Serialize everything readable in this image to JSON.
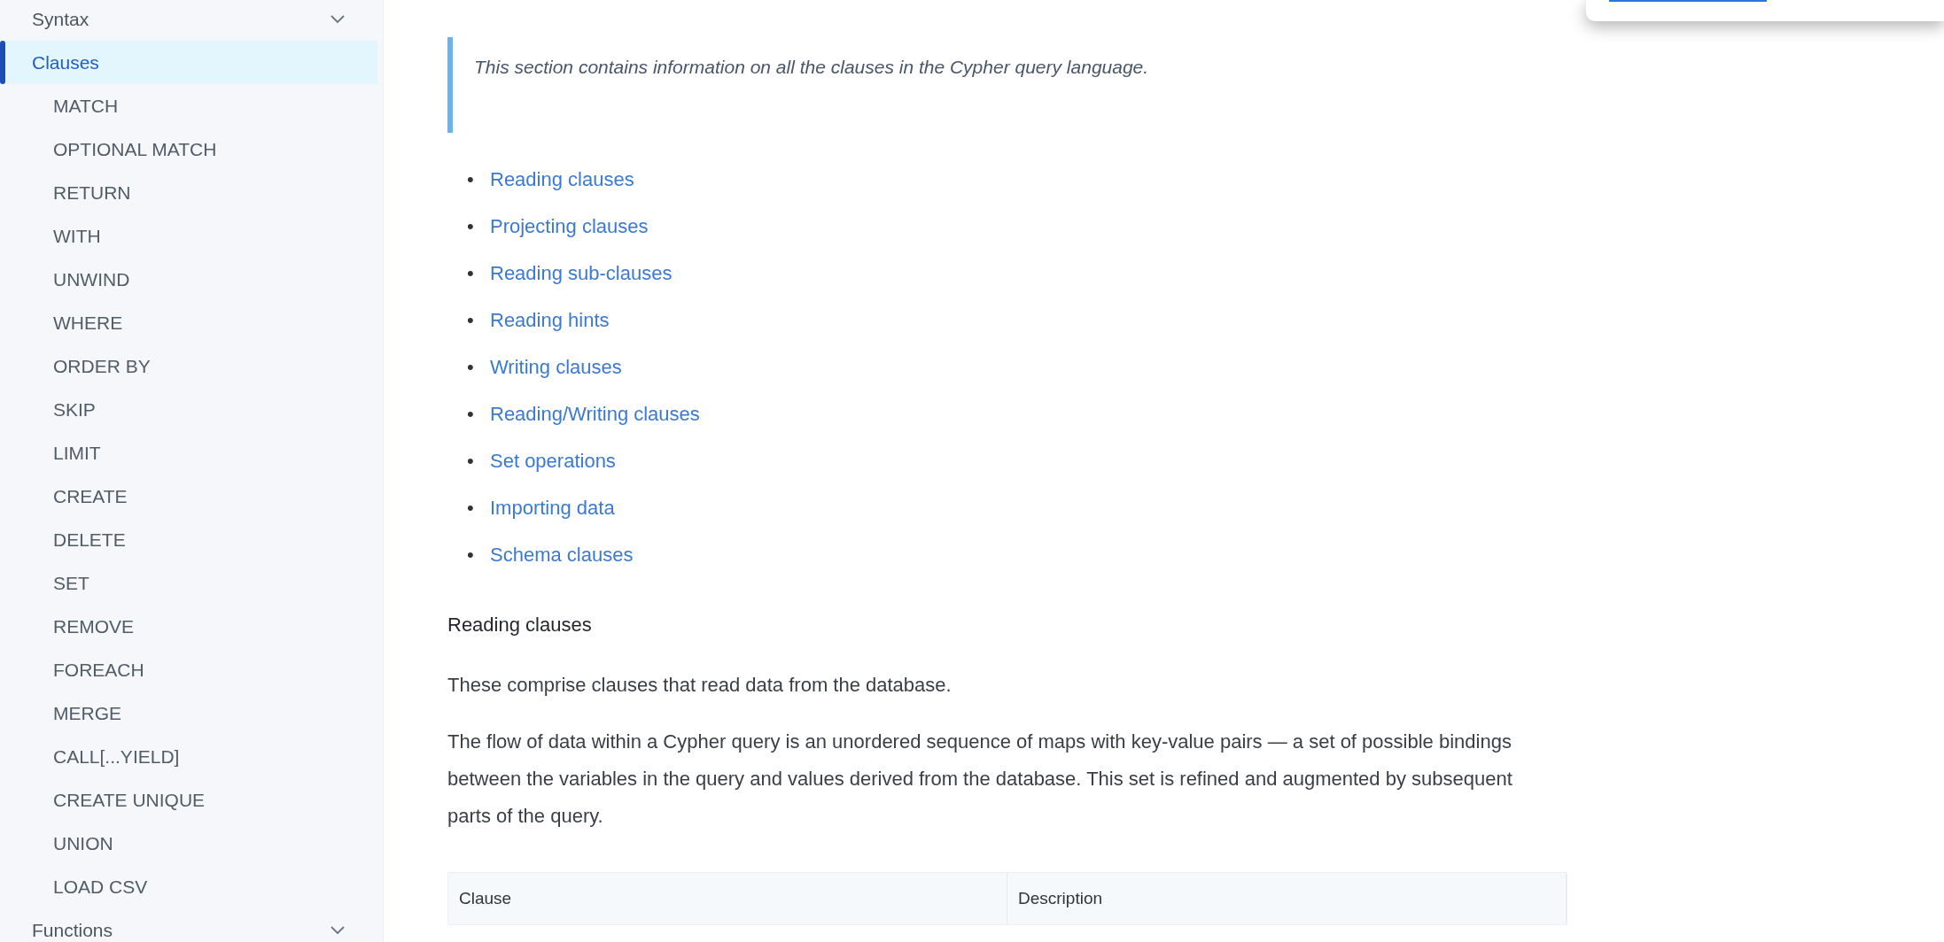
{
  "sidebar": {
    "items": [
      {
        "label": "Syntax",
        "kind": "section",
        "selected": false
      },
      {
        "label": "Clauses",
        "kind": "page",
        "selected": true,
        "children": [
          {
            "label": "MATCH",
            "selected": false
          },
          {
            "label": "OPTIONAL MATCH",
            "selected": false
          },
          {
            "label": "RETURN",
            "selected": false
          },
          {
            "label": "WITH",
            "selected": false
          },
          {
            "label": "UNWIND",
            "selected": false
          },
          {
            "label": "WHERE",
            "selected": false
          },
          {
            "label": "ORDER BY",
            "selected": false
          },
          {
            "label": "SKIP",
            "selected": false
          },
          {
            "label": "LIMIT",
            "selected": false
          },
          {
            "label": "CREATE",
            "selected": false
          },
          {
            "label": "DELETE",
            "selected": false
          },
          {
            "label": "SET",
            "selected": false
          },
          {
            "label": "REMOVE",
            "selected": false
          },
          {
            "label": "FOREACH",
            "selected": false
          },
          {
            "label": "MERGE",
            "selected": false
          },
          {
            "label": "CALL[...YIELD]",
            "selected": false
          },
          {
            "label": "CREATE UNIQUE",
            "selected": false
          },
          {
            "label": "UNION",
            "selected": false
          },
          {
            "label": "LOAD CSV",
            "selected": false
          }
        ]
      },
      {
        "label": "Functions",
        "kind": "section",
        "selected": false
      }
    ]
  },
  "content": {
    "intro": "This section contains information on all the clauses in the Cypher query language.",
    "links": [
      {
        "marker": "•",
        "label": "Reading clauses"
      },
      {
        "marker": "•",
        "label": "Projecting clauses"
      },
      {
        "marker": "•",
        "label": "Reading sub-clauses"
      },
      {
        "marker": "•",
        "label": "Reading hints"
      },
      {
        "marker": "•",
        "label": "Writing clauses"
      },
      {
        "marker": "•",
        "label": "Reading/Writing clauses"
      },
      {
        "marker": "•",
        "label": "Set operations"
      },
      {
        "marker": "•",
        "label": "Importing data"
      },
      {
        "marker": "•",
        "label": "Schema clauses"
      }
    ],
    "heading": "Reading clauses",
    "paragraphs": [
      "These comprise clauses that read data from the database.",
      "The flow of data within a Cypher query is an unordered sequence of maps with key-value pairs — a set of possible bindings between the variables in the query and values derived from the database. This set is refined and augmented by subsequent parts of the query."
    ],
    "table": {
      "columns": [
        "Clause",
        "Description"
      ]
    }
  }
}
